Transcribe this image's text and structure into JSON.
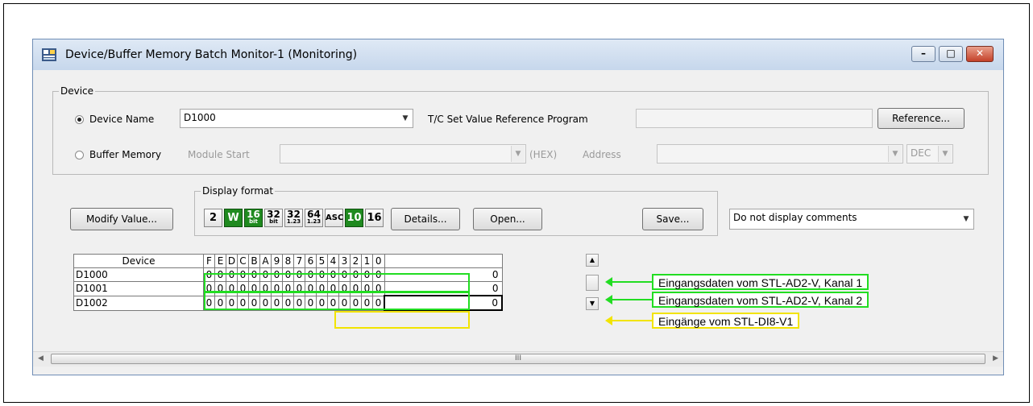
{
  "window": {
    "title": "Device/Buffer Memory Batch Monitor-1 (Monitoring)",
    "icon": "monitor-app-icon",
    "controls": {
      "minimize": "–",
      "maximize": "□",
      "close": "✕"
    }
  },
  "device_group": {
    "legend": "Device",
    "device_name_label": "Device Name",
    "device_name_value": "D1000",
    "tc_label": "T/C Set Value Reference Program",
    "tc_value": "",
    "reference_button": "Reference...",
    "buffer_memory_label": "Buffer Memory",
    "module_start_label": "Module Start",
    "module_start_value": "",
    "hex_label": "(HEX)",
    "address_label": "Address",
    "address_value": "",
    "radix_value": "DEC",
    "selected": "device_name"
  },
  "modify_value_button": "Modify Value...",
  "display_format": {
    "legend": "Display format",
    "buttons": [
      "2",
      "W",
      "16 bit",
      "32 bit",
      "32 1.23",
      "64 1.23",
      "ASC",
      "10",
      "16"
    ],
    "selected": [
      "W",
      "10"
    ],
    "details_button": "Details...",
    "open_button": "Open...",
    "save_button": "Save..."
  },
  "comments_select": {
    "value": "Do not display comments"
  },
  "grid": {
    "device_header": "Device",
    "bit_headers": [
      "F",
      "E",
      "D",
      "C",
      "B",
      "A",
      "9",
      "8",
      "7",
      "6",
      "5",
      "4",
      "3",
      "2",
      "1",
      "0"
    ],
    "rows": [
      {
        "device": "D1000",
        "bits": [
          "0",
          "0",
          "0",
          "0",
          "0",
          "0",
          "0",
          "0",
          "0",
          "0",
          "0",
          "0",
          "0",
          "0",
          "0",
          "0"
        ],
        "value": "0"
      },
      {
        "device": "D1001",
        "bits": [
          "0",
          "0",
          "0",
          "0",
          "0",
          "0",
          "0",
          "0",
          "0",
          "0",
          "0",
          "0",
          "0",
          "0",
          "0",
          "0"
        ],
        "value": "0"
      },
      {
        "device": "D1002",
        "bits": [
          "0",
          "0",
          "0",
          "0",
          "0",
          "0",
          "0",
          "0",
          "0",
          "0",
          "0",
          "0",
          "0",
          "0",
          "0",
          "0"
        ],
        "value": "0"
      }
    ]
  },
  "annotations": [
    {
      "text": "Eingangsdaten vom STL-AD2-V, Kanal 1",
      "color": "#22dd22"
    },
    {
      "text": "Eingangsdaten vom STL-AD2-V, Kanal 2",
      "color": "#22dd22"
    },
    {
      "text": "Eingänge vom STL-DI8-V1",
      "color": "#f2e400"
    }
  ],
  "hscroll": {
    "grip": "III"
  }
}
